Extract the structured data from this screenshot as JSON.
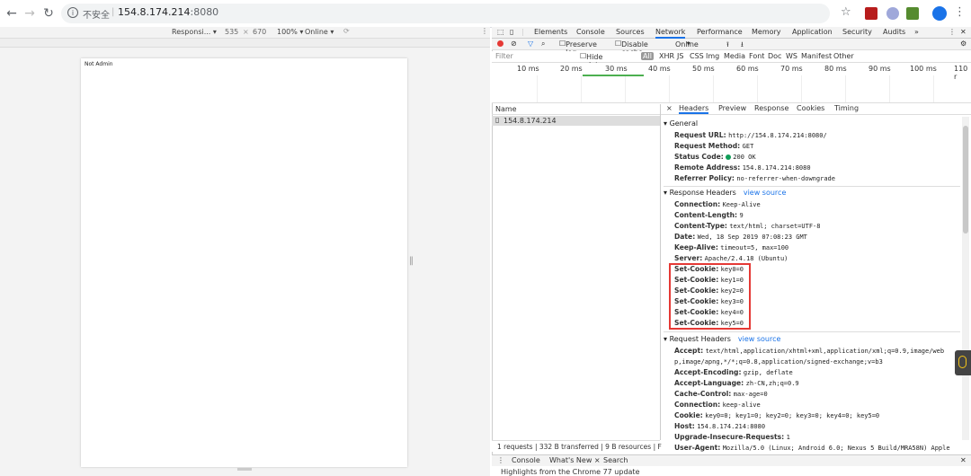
{
  "browser": {
    "insecure_label": "不安全",
    "url_host": "154.8.174.214",
    "url_port": ":8080"
  },
  "device_toolbar": {
    "device": "Responsi...",
    "width": "535",
    "times": "×",
    "height": "670",
    "zoom": "100%",
    "throttle": "Online"
  },
  "page": {
    "content_text": "Not Admin"
  },
  "devtools": {
    "tabs": [
      "Elements",
      "Console",
      "Sources",
      "Network",
      "Performance",
      "Memory",
      "Application",
      "Security",
      "Audits",
      "»"
    ],
    "active_tab": "Network",
    "preserve_log": "Preserve log",
    "disable_cache": "Disable cache",
    "online": "Online",
    "filter_placeholder": "Filter",
    "hide_data_urls": "Hide data URLs",
    "filter_types": [
      "All",
      "XHR",
      "JS",
      "CSS",
      "Img",
      "Media",
      "Font",
      "Doc",
      "WS",
      "Manifest",
      "Other"
    ],
    "timeline_ticks": [
      "10 ms",
      "20 ms",
      "30 ms",
      "40 ms",
      "50 ms",
      "60 ms",
      "70 ms",
      "80 ms",
      "90 ms",
      "100 ms",
      "110 r"
    ],
    "name_header": "Name",
    "request_name": "154.8.174.214",
    "detail_tabs": [
      "×",
      "Headers",
      "Preview",
      "Response",
      "Cookies",
      "Timing"
    ],
    "general": {
      "title": "General",
      "rows": [
        {
          "k": "Request URL:",
          "v": "http://154.8.174.214:8080/"
        },
        {
          "k": "Request Method:",
          "v": "GET"
        },
        {
          "k": "Status Code:",
          "v": "200 OK"
        },
        {
          "k": "Remote Address:",
          "v": "154.8.174.214:8080"
        },
        {
          "k": "Referrer Policy:",
          "v": "no-referrer-when-downgrade"
        }
      ]
    },
    "response_headers": {
      "title": "Response Headers",
      "view_source": "view source",
      "rows": [
        {
          "k": "Connection:",
          "v": "Keep-Alive"
        },
        {
          "k": "Content-Length:",
          "v": "9"
        },
        {
          "k": "Content-Type:",
          "v": "text/html; charset=UTF-8"
        },
        {
          "k": "Date:",
          "v": "Wed, 18 Sep 2019 07:08:23 GMT"
        },
        {
          "k": "Keep-Alive:",
          "v": "timeout=5, max=100"
        },
        {
          "k": "Server:",
          "v": "Apache/2.4.18 (Ubuntu)"
        },
        {
          "k": "Set-Cookie:",
          "v": "key0=0"
        },
        {
          "k": "Set-Cookie:",
          "v": "key1=0"
        },
        {
          "k": "Set-Cookie:",
          "v": "key2=0"
        },
        {
          "k": "Set-Cookie:",
          "v": "key3=0"
        },
        {
          "k": "Set-Cookie:",
          "v": "key4=0"
        },
        {
          "k": "Set-Cookie:",
          "v": "key5=0"
        }
      ]
    },
    "request_headers": {
      "title": "Request Headers",
      "view_source": "view source",
      "rows": [
        {
          "k": "Accept:",
          "v": "text/html,application/xhtml+xml,application/xml;q=0.9,image/web"
        },
        {
          "k": "",
          "v": "p,image/apng,*/*;q=0.8,application/signed-exchange;v=b3"
        },
        {
          "k": "Accept-Encoding:",
          "v": "gzip, deflate"
        },
        {
          "k": "Accept-Language:",
          "v": "zh-CN,zh;q=0.9"
        },
        {
          "k": "Cache-Control:",
          "v": "max-age=0"
        },
        {
          "k": "Connection:",
          "v": "keep-alive"
        },
        {
          "k": "Cookie:",
          "v": "key0=0; key1=0; key2=0; key3=0; key4=0; key5=0"
        },
        {
          "k": "Host:",
          "v": "154.8.174.214:8080"
        },
        {
          "k": "Upgrade-Insecure-Requests:",
          "v": "1"
        },
        {
          "k": "User-Agent:",
          "v": "Mozilla/5.0 (Linux; Android 6.0; Nexus 5 Build/MRA58N) Apple"
        }
      ]
    },
    "status": "1 requests  |  332 B transferred  |  9 B resources  |  F",
    "drawer_tabs": [
      "Console",
      "What's New ×",
      "Search"
    ],
    "drawer_text": "Highlights from the Chrome 77 update"
  },
  "colors": {
    "highlight": "#e53935",
    "accent": "#1a73e8",
    "status_ok": "#0f9d58"
  }
}
